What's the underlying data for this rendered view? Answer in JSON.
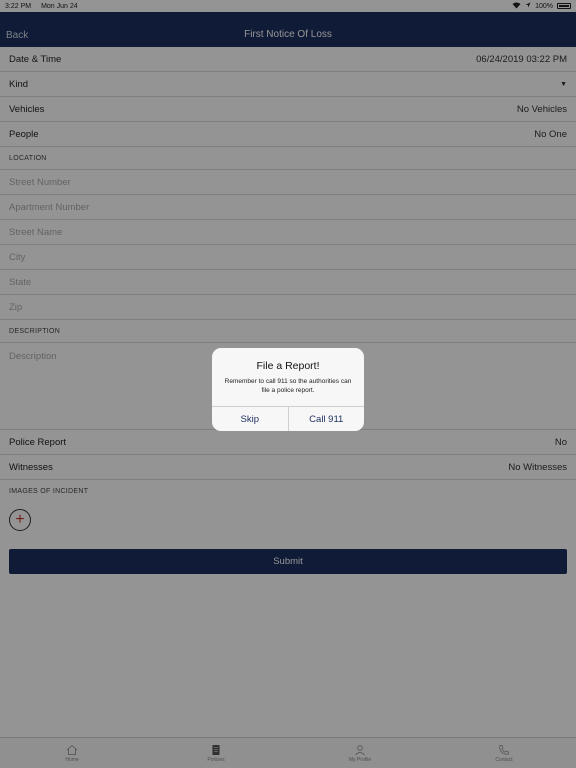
{
  "status": {
    "time": "3:22 PM",
    "date": "Mon Jun 24",
    "battery": "100%"
  },
  "nav": {
    "back": "Back",
    "title": "First Notice Of Loss"
  },
  "form": {
    "datetime": {
      "label": "Date & Time",
      "value": "06/24/2019 03:22 PM"
    },
    "kind": {
      "label": "Kind"
    },
    "vehicles": {
      "label": "Vehicles",
      "value": "No Vehicles"
    },
    "people": {
      "label": "People",
      "value": "No One"
    },
    "location_header": "LOCATION",
    "street_number": "Street Number",
    "apartment_number": "Apartment Number",
    "street_name": "Street Name",
    "city": "City",
    "state": "State",
    "zip": "Zip",
    "description_header": "DESCRIPTION",
    "description_placeholder": "Description",
    "police_report": {
      "label": "Police Report",
      "value": "No"
    },
    "witnesses": {
      "label": "Witnesses",
      "value": "No Witnesses"
    },
    "images_header": "IMAGES OF INCIDENT",
    "add_image": "+",
    "submit": "Submit"
  },
  "tabs": [
    {
      "label": "Home",
      "icon": "home-icon"
    },
    {
      "label": "Policies",
      "icon": "policies-icon"
    },
    {
      "label": "My Profile",
      "icon": "profile-icon"
    },
    {
      "label": "Contact",
      "icon": "phone-icon"
    }
  ],
  "alert": {
    "title": "File a Report!",
    "message": "Remember to call 911 so the authorities can file a police report.",
    "skip": "Skip",
    "call": "Call 911"
  },
  "colors": {
    "primary": "#1c2f5f",
    "accent": "#c0392b"
  }
}
